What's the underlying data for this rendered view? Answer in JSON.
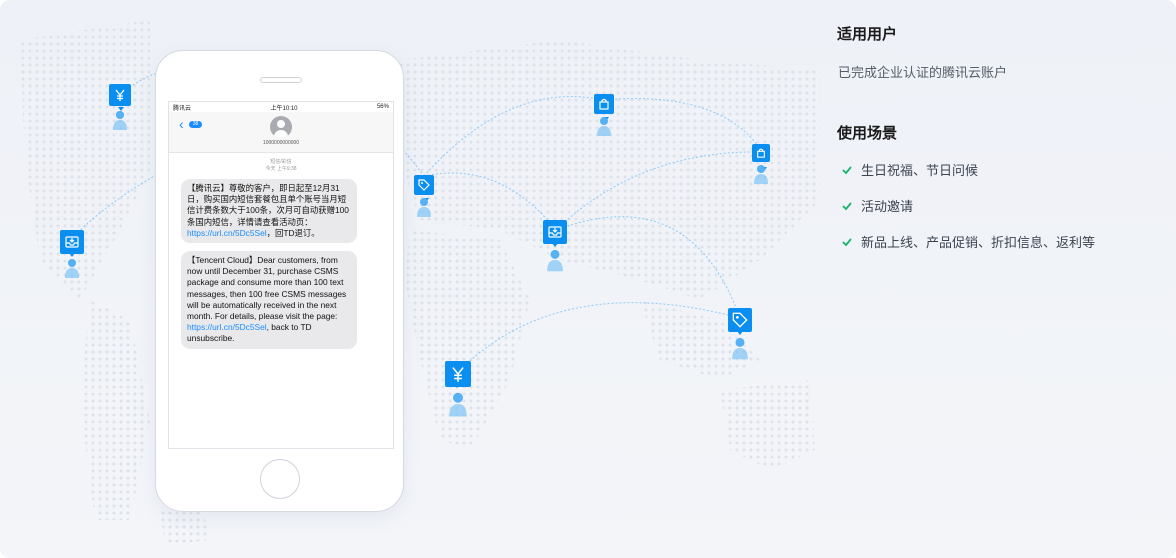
{
  "section1": {
    "title": "适用用户",
    "desc": "已完成企业认证的腾讯云账户"
  },
  "section2": {
    "title": "使用场景",
    "items": [
      "生日祝福、节日问候",
      "活动邀请",
      "新品上线、产品促销、折扣信息、返利等"
    ]
  },
  "phone": {
    "status_left": "腾讯云",
    "status_time": "上午10:10",
    "status_battery": "56%",
    "back_badge": "38",
    "contact_number": "1000000000000",
    "message_meta_1": "短信/彩信",
    "message_meta_2": "今天 上午9:38",
    "sms_cn_text": "【腾讯云】尊敬的客户，即日起至12月31日，购买国内短信套餐包且单个账号当月短信计费条数大于100条，次月可自动获赠100条国内短信，详情请查看活动页：",
    "sms_cn_link": "https://url.cn/5Dc5Sel",
    "sms_cn_tail": "，回TD退订。",
    "sms_en_text": "【Tencent Cloud】Dear customers, from now until December 31, purchase CSMS package and consume more than 100 text messages, then 100 free CSMS messages will be automatically received in the next month. For details, please visit the page: ",
    "sms_en_link": "https://url.cn/5Dc5Sel",
    "sms_en_tail": ", back to TD unsubscribe."
  },
  "colors": {
    "accent": "#0a8ff0",
    "check": "#19b36b"
  },
  "icons": [
    "yen-icon",
    "inbox-icon",
    "tag-icon",
    "shopping-bag-icon",
    "person-icon",
    "check-icon"
  ]
}
